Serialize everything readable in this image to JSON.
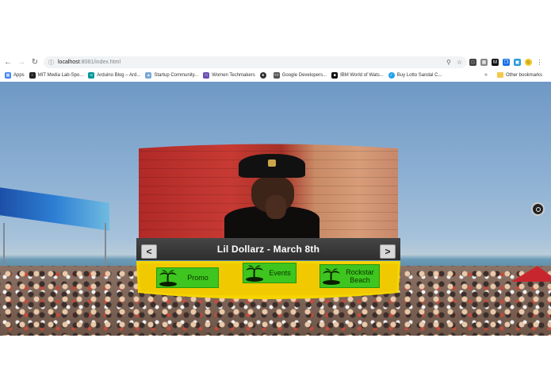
{
  "browser": {
    "url_host": "localhost",
    "url_rest": ":8081/index.html",
    "bookmarks": [
      {
        "label": "Apps",
        "icon": "apps-grid-icon",
        "color": "#4285f4"
      },
      {
        "label": "MIT Media Lab-Spo...",
        "icon": "mit-icon",
        "color": "#222222"
      },
      {
        "label": "Arduino Blog – Ard...",
        "icon": "arduino-icon",
        "color": "#00979d"
      },
      {
        "label": "Startup Community...",
        "icon": "startup-icon",
        "color": "#7aa9d6"
      },
      {
        "label": "Women Techmakers",
        "icon": "women-tech-icon",
        "color": "#6a4fb3"
      },
      {
        "label": "",
        "icon": "globe-icon",
        "color": "#333333"
      },
      {
        "label": "Google Developers...",
        "icon": "code-icon",
        "color": "#555555"
      },
      {
        "label": "IBM World of Wats...",
        "icon": "ibm-icon",
        "color": "#111111"
      },
      {
        "label": "Buy Lotto Sandal C...",
        "icon": "lotto-icon",
        "color": "#1da1f2"
      }
    ],
    "more_bookmarks": "»",
    "other_bookmarks": "Other bookmarks"
  },
  "screen": {
    "title": "Lil Dollarz - March 8th",
    "prev_label": "<",
    "next_label": ">"
  },
  "menu": [
    {
      "label": "Promo",
      "icon": "palm-tree-icon"
    },
    {
      "label": "Events",
      "icon": "palm-tree-icon"
    },
    {
      "label": "Rockstar Beach",
      "icon": "palm-tree-icon"
    }
  ],
  "colors": {
    "menu_band": "#f5d400",
    "menu_button": "#3ec51f",
    "title_bar": "#3a3a3a"
  }
}
